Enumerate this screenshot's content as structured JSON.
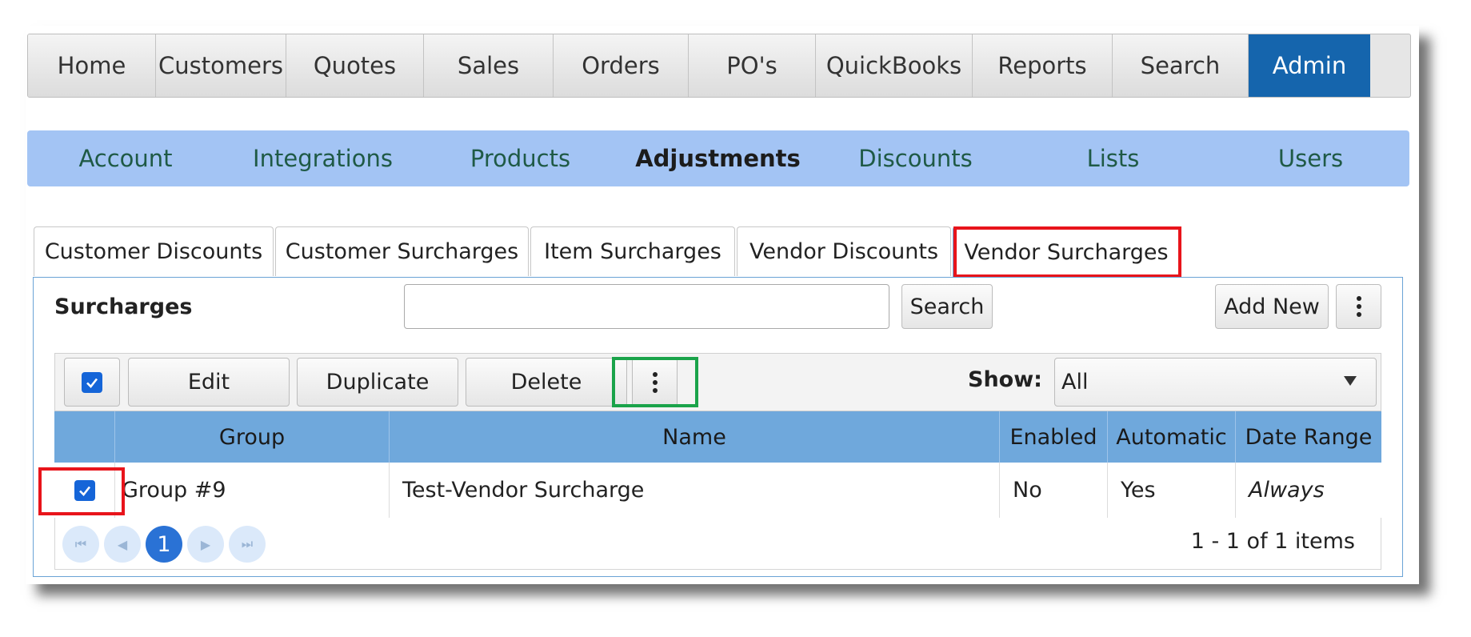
{
  "main_nav": {
    "items": [
      "Home",
      "Customers",
      "Quotes",
      "Sales",
      "Orders",
      "PO's",
      "QuickBooks",
      "Reports",
      "Search",
      "Admin"
    ],
    "active": "Admin"
  },
  "sub_nav": {
    "items": [
      "Account",
      "Integrations",
      "Products",
      "Adjustments",
      "Discounts",
      "Lists",
      "Users"
    ],
    "active": "Adjustments"
  },
  "tabs": {
    "items": [
      "Customer Discounts",
      "Customer Surcharges",
      "Item Surcharges",
      "Vendor Discounts",
      "Vendor Surcharges"
    ],
    "active": "Vendor Surcharges"
  },
  "panel": {
    "title": "Surcharges",
    "search_value": "",
    "search_button": "Search",
    "add_new_button": "Add New"
  },
  "toolbar": {
    "select_all_checked": true,
    "edit": "Edit",
    "duplicate": "Duplicate",
    "delete": "Delete",
    "show_label": "Show:",
    "show_value": "All"
  },
  "table": {
    "headers": [
      "Group",
      "Name",
      "Enabled",
      "Automatic",
      "Date Range"
    ],
    "rows": [
      {
        "checked": true,
        "group": "Group #9",
        "name": "Test-Vendor Surcharge",
        "enabled": "No",
        "automatic": "Yes",
        "date_range": "Always"
      }
    ]
  },
  "pager": {
    "current_page": "1",
    "info": "1 - 1 of 1 items"
  },
  "colors": {
    "admin_active": "#1565ad",
    "subnav_bg": "#a3c4f4",
    "table_header": "#6fa8dc",
    "checkbox": "#1565d8",
    "annotation_red": "#e8141b",
    "annotation_green": "#1aa34a"
  }
}
